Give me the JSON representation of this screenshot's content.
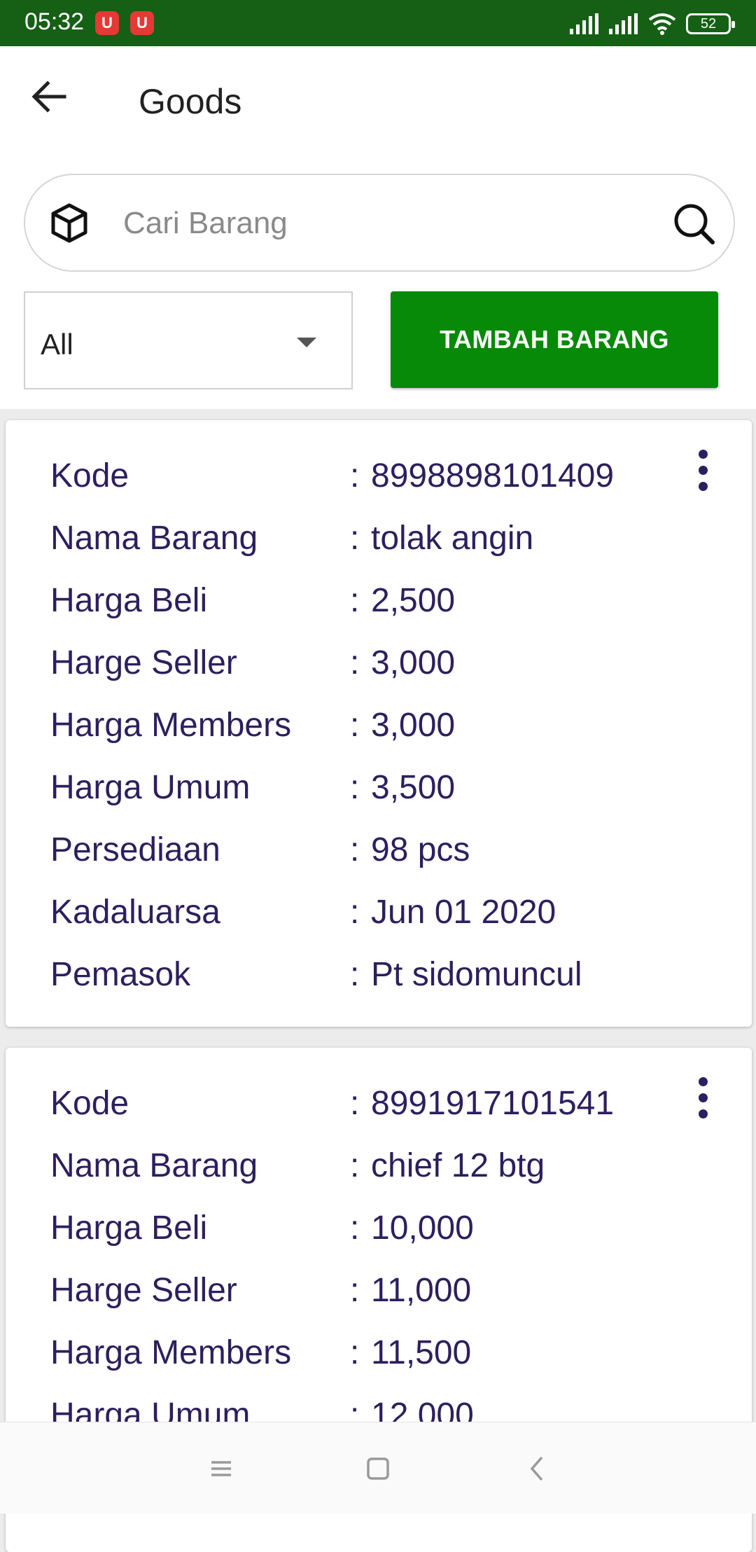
{
  "status_bar": {
    "time": "05:32",
    "notification_icons": [
      "u-app-icon",
      "u-app-icon"
    ],
    "battery": "52",
    "icons": [
      "signal-icon",
      "signal-icon",
      "wifi-icon",
      "battery-icon"
    ]
  },
  "app_bar": {
    "title": "Goods",
    "back_icon": "arrow-left-icon"
  },
  "search": {
    "placeholder": "Cari Barang",
    "value": "",
    "leading_icon": "box-icon",
    "trailing_icon": "search-icon"
  },
  "filter": {
    "selected": "All"
  },
  "add_button": {
    "label": "TAMBAH BARANG",
    "color": "#078a07"
  },
  "goods": [
    {
      "rows": [
        {
          "label": "Kode",
          "value": "8998898101409"
        },
        {
          "label": "Nama Barang",
          "value": "tolak angin"
        },
        {
          "label": "Harga Beli",
          "value": "2,500"
        },
        {
          "label": "Harge Seller",
          "value": "3,000"
        },
        {
          "label": "Harga Members",
          "value": "3,000"
        },
        {
          "label": "Harga Umum",
          "value": "3,500"
        },
        {
          "label": "Persediaan",
          "value": "98 pcs"
        },
        {
          "label": "Kadaluarsa",
          "value": "Jun 01 2020"
        },
        {
          "label": "Pemasok",
          "value": "Pt sidomuncul"
        }
      ]
    },
    {
      "rows": [
        {
          "label": "Kode",
          "value": "8991917101541"
        },
        {
          "label": "Nama Barang",
          "value": "chief 12 btg"
        },
        {
          "label": "Harga Beli",
          "value": "10,000"
        },
        {
          "label": "Harge Seller",
          "value": "11,000"
        },
        {
          "label": "Harga Members",
          "value": "11,500"
        },
        {
          "label": "Harga Umum",
          "value": "12,000"
        }
      ]
    }
  ],
  "colon": ":",
  "colors": {
    "status_bar": "#156015",
    "text_primary": "#2d1f5e"
  },
  "nav_bar": {
    "icons": [
      "menu-icon",
      "home-square-icon",
      "back-chevron-icon"
    ]
  }
}
